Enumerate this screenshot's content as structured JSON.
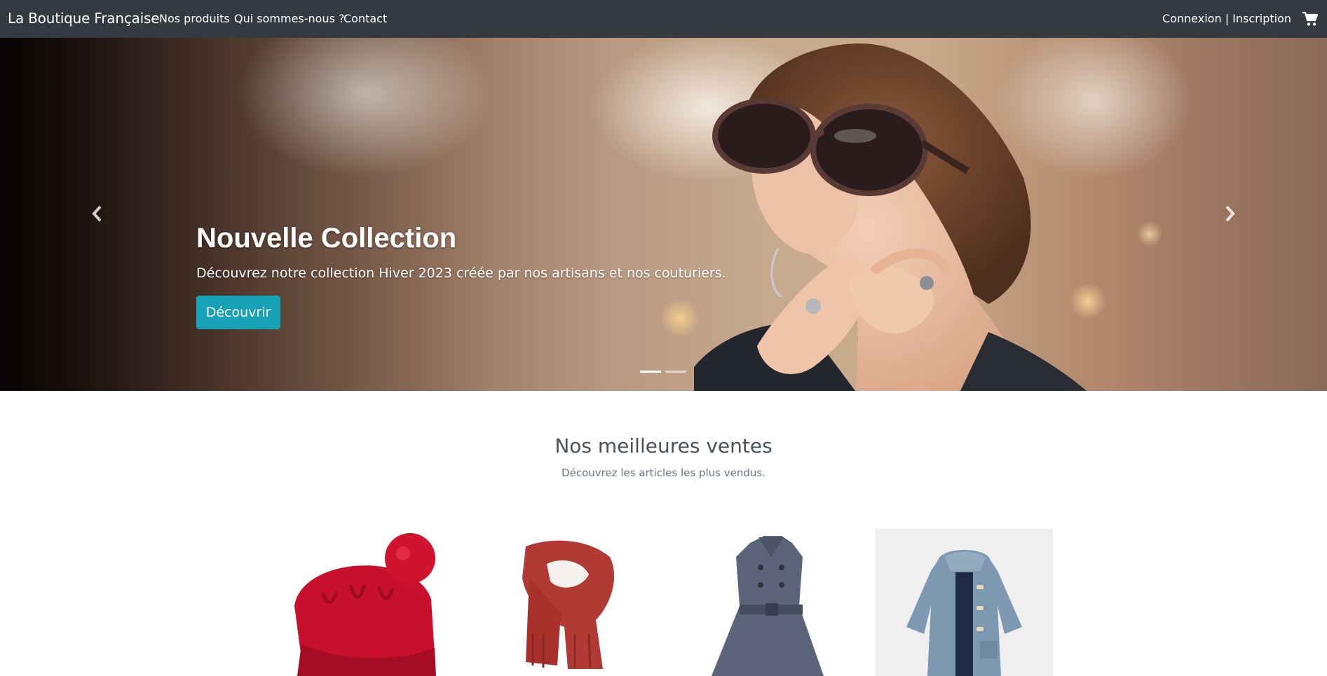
{
  "navbar": {
    "brand": "La Boutique Française",
    "links": [
      "Nos produits",
      "Qui sommes-nous ?",
      "Contact"
    ],
    "login": "Connexion",
    "separator": "|",
    "signup": "Inscription",
    "cart_icon": "cart-icon"
  },
  "hero": {
    "title": "Nouvelle Collection",
    "subtitle": "Découvrez notre collection Hiver 2023 créée par nos artisans et nos couturiers.",
    "button": "Découvrir",
    "prev_icon": "chevron-left-icon",
    "next_icon": "chevron-right-icon",
    "slide_count": 2,
    "active_slide": 1,
    "accent": "#17a2b8"
  },
  "bestsellers": {
    "title": "Nos meilleures ventes",
    "subtitle": "Découvrez les articles les plus vendus."
  },
  "colors": {
    "navbar": "#343a40",
    "accent": "#17a2b8",
    "heading": "#495057",
    "muted": "#6c757d"
  }
}
